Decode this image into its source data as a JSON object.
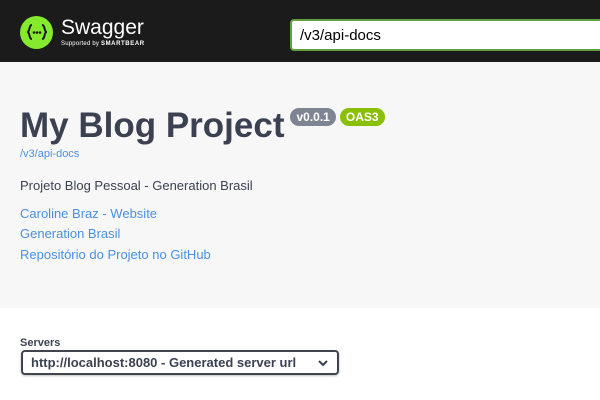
{
  "topbar": {
    "brand": "Swagger",
    "supported_by": "Supported by",
    "supporter": "SMARTBEAR",
    "url_value": "/v3/api-docs"
  },
  "info": {
    "title": "My Blog Project",
    "version_badge": "v0.0.1",
    "oas_badge": "OAS3",
    "docs_link": "/v3/api-docs",
    "description": "Projeto Blog Pessoal - Generation Brasil",
    "links": [
      "Caroline Braz - Website",
      "Generation Brasil",
      "Repositório do Projeto no GitHub"
    ]
  },
  "servers": {
    "label": "Servers",
    "selected": "http://localhost:8080 - Generated server url"
  },
  "colors": {
    "topbar_bg": "#1b1b1b",
    "logo_green": "#85ea2d",
    "link": "#4990e2",
    "version_badge": "#7d8492",
    "oas_badge": "#89bf04"
  }
}
